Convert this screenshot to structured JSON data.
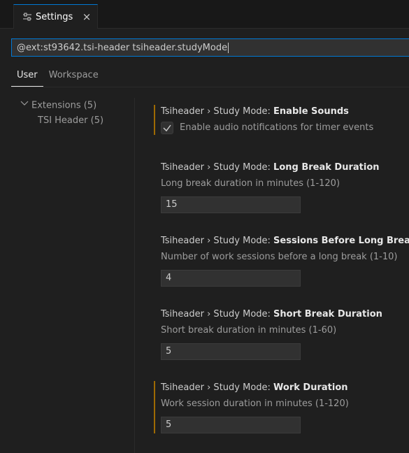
{
  "editor_tab": {
    "title": "Settings",
    "icon": "settings-sliders-icon",
    "close_glyph": "×"
  },
  "search": {
    "value": "@ext:st93642.tsi-header tsiheader.studyMode"
  },
  "scopes": [
    {
      "label": "User",
      "active": true
    },
    {
      "label": "Workspace",
      "active": false
    }
  ],
  "toc": [
    {
      "label": "Extensions (5)",
      "expanded": true
    },
    {
      "label": "TSI Header (5)"
    }
  ],
  "settings": [
    {
      "category": "Tsiheader › Study Mode: ",
      "key": "Enable Sounds",
      "type": "checkbox",
      "checked": true,
      "description": "Enable audio notifications for timer events",
      "modified": true
    },
    {
      "category": "Tsiheader › Study Mode: ",
      "key": "Long Break Duration",
      "type": "number",
      "description": "Long break duration in minutes (1-120)",
      "value": "15",
      "modified": false
    },
    {
      "category": "Tsiheader › Study Mode: ",
      "key": "Sessions Before Long Break",
      "type": "number",
      "description": "Number of work sessions before a long break (1-10)",
      "value": "4",
      "modified": false
    },
    {
      "category": "Tsiheader › Study Mode: ",
      "key": "Short Break Duration",
      "type": "number",
      "description": "Short break duration in minutes (1-60)",
      "value": "5",
      "modified": false
    },
    {
      "category": "Tsiheader › Study Mode: ",
      "key": "Work Duration",
      "type": "number",
      "description": "Work session duration in minutes (1-120)",
      "value": "5",
      "modified": true
    }
  ],
  "colors": {
    "accent": "#0078d4",
    "modified_indicator": "#9e6a03",
    "background": "#1f1f1f"
  }
}
